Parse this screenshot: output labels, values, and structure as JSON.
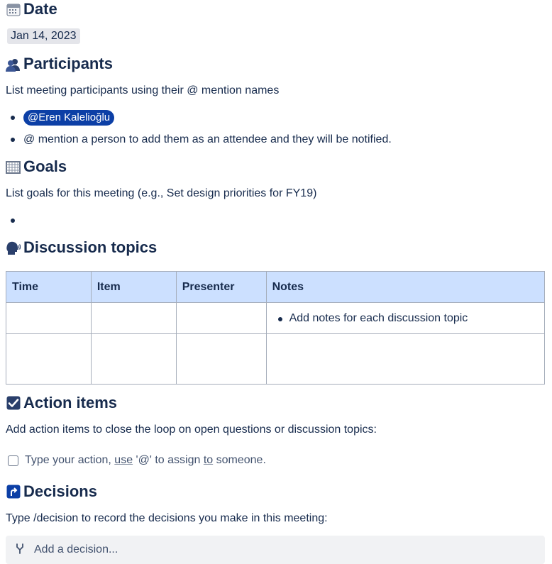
{
  "sections": {
    "date": {
      "heading": "Date",
      "value": "Jan 14, 2023",
      "icon": "calendar-icon"
    },
    "participants": {
      "heading": "Participants",
      "description": "List meeting participants using their @ mention names",
      "mention": "@Eren Kalelioğlu",
      "hint": "@ mention a person to add them as an attendee and they will be notified.",
      "icon": "people-icon"
    },
    "goals": {
      "heading": "Goals",
      "description": "List goals for this meeting (e.g., Set design priorities for FY19)",
      "icon": "goal-net-icon"
    },
    "discussion": {
      "heading": "Discussion topics",
      "icon": "speaking-head-icon",
      "table": {
        "headers": [
          "Time",
          "Item",
          "Presenter",
          "Notes"
        ],
        "row1_note": "Add notes for each discussion topic"
      }
    },
    "action_items": {
      "heading": "Action items",
      "description": "Add action items to close the loop on open questions or discussion topics:",
      "task": {
        "part1": "Type your action, ",
        "use": "use",
        "part2": " '@' to assign ",
        "to": "to",
        "part3": " someone."
      },
      "icon": "checkbox-icon"
    },
    "decisions": {
      "heading": "Decisions",
      "description": "Type /decision to record the decisions you make in this meeting:",
      "placeholder": "Add a decision...",
      "icon": "decision-arrow-icon"
    }
  },
  "colors": {
    "text": "#172b4d",
    "mention_bg": "#0c3fa6",
    "table_header_bg": "#cce0ff",
    "check_icon": "#172b4d",
    "decision_icon": "#0c3fa6"
  }
}
